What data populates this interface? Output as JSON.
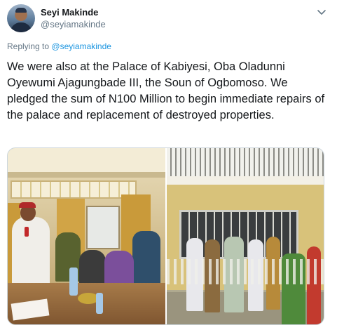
{
  "author": {
    "name": "Seyi Makinde",
    "handle": "@seyiamakinde"
  },
  "reply": {
    "prefix": "Replying to",
    "to_handle": "@seyiamakinde"
  },
  "tweet": {
    "text": "We were also at the Palace of Kabiyesi, Oba Oladunni Oyewumi Ajagungbade III, the Soun of Ogbomoso. We pledged the sum of N100 Million to begin immediate repairs of the palace and replacement of destroyed properties."
  },
  "icons": {
    "more": "chevron-down-icon"
  },
  "colors": {
    "link": "#1b95e0",
    "secondary_text": "#657786",
    "primary_text": "#14171a"
  }
}
